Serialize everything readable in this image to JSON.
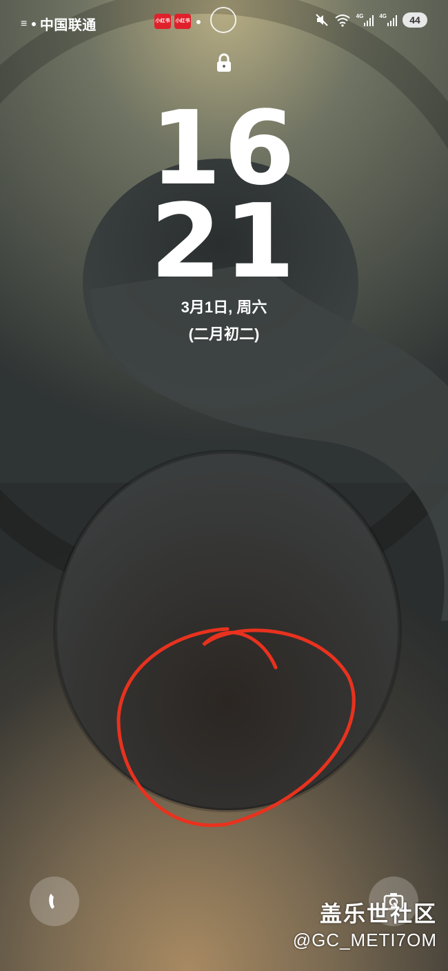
{
  "status_bar": {
    "carrier": "中国联通",
    "badge_left": "小红书",
    "badge_right": "小红书",
    "network_a": "4G",
    "network_b": "4G",
    "battery": "44"
  },
  "lock": {
    "hour": "16",
    "minute": "21",
    "date": "3月1日, 周六",
    "lunar_date": "(二月初二)"
  },
  "shortcuts": {
    "left_icon": "phone-icon",
    "right_icon": "camera-icon"
  },
  "watermark": {
    "title": "盖乐世社区",
    "handle": "@GC_METI7OM"
  },
  "colors": {
    "annotation": "#e8321e",
    "battery_bg": "#e8e8e8"
  }
}
